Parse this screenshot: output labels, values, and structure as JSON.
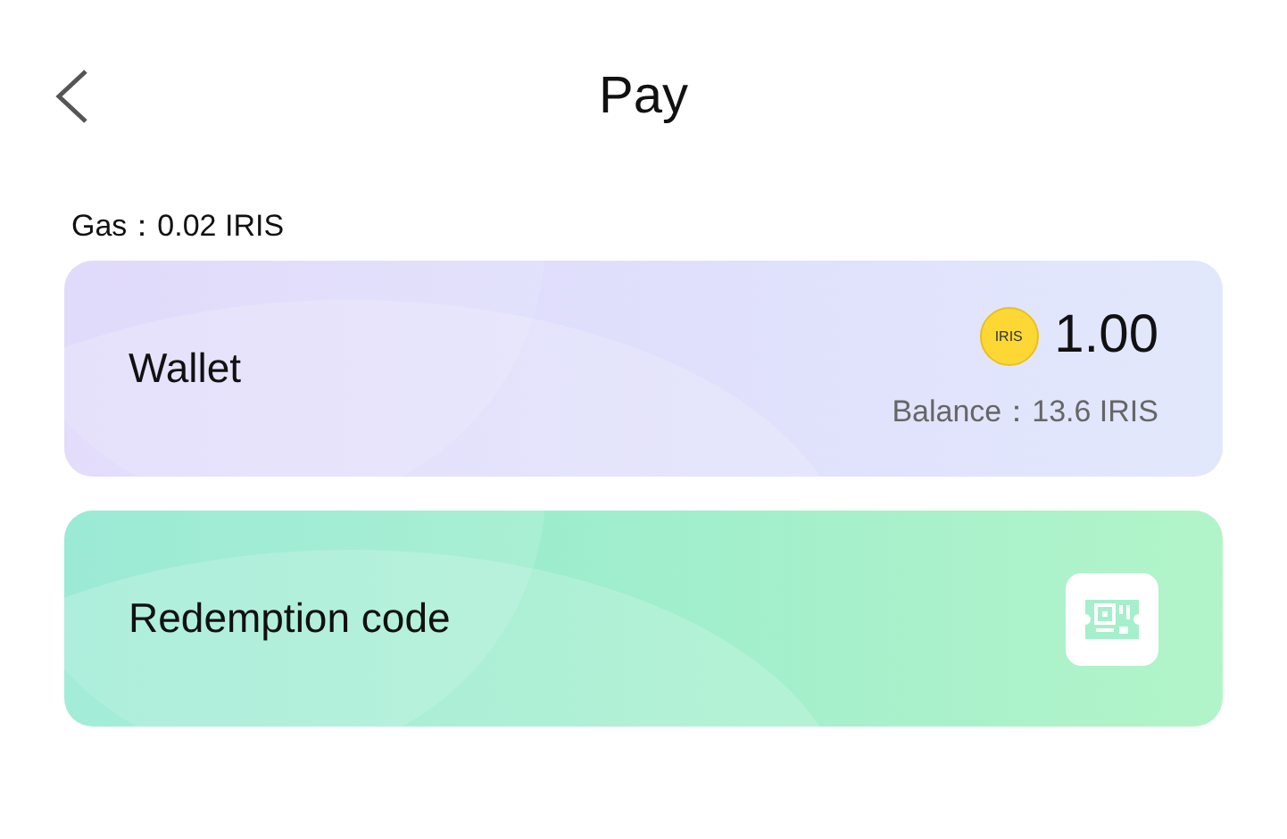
{
  "header": {
    "title": "Pay"
  },
  "gas": "Gas：0.02 IRIS",
  "options": [
    {
      "kind": "wallet",
      "label": "Wallet",
      "coin": "IRIS",
      "amount": "1.00",
      "balance": "Balance：13.6 IRIS"
    },
    {
      "kind": "code",
      "label": "Redemption code"
    }
  ]
}
